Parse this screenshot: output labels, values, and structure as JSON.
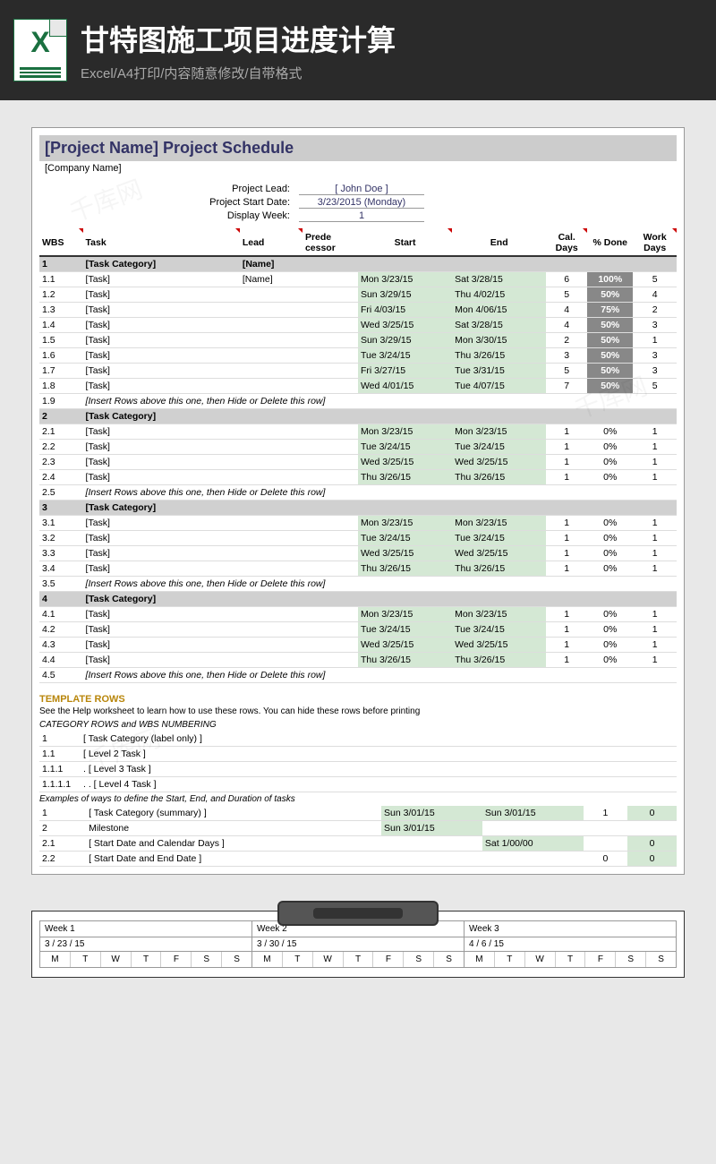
{
  "header": {
    "title": "甘特图施工项目进度计算",
    "subtitle": "Excel/A4打印/内容随意修改/自带格式"
  },
  "sheet": {
    "title": "[Project Name] Project Schedule",
    "company": "[Company Name]",
    "info": {
      "lead_lbl": "Project Lead:",
      "lead": "[ John Doe ]",
      "start_lbl": "Project Start Date:",
      "start": "3/23/2015 (Monday)",
      "week_lbl": "Display Week:",
      "week": "1"
    },
    "cols": {
      "wbs": "WBS",
      "task": "Task",
      "lead": "Lead",
      "pred": "Prede cessor",
      "start": "Start",
      "end": "End",
      "cal": "Cal. Days",
      "pct": "% Done",
      "work": "Work Days"
    },
    "rows": [
      {
        "t": "cat",
        "wbs": "1",
        "task": "[Task Category]",
        "lead": "[Name]"
      },
      {
        "wbs": "1.1",
        "task": "[Task]",
        "lead": "[Name]",
        "start": "Mon 3/23/15",
        "end": "Sat 3/28/15",
        "cal": "6",
        "pct": "100%",
        "work": "5"
      },
      {
        "wbs": "1.2",
        "task": "[Task]",
        "start": "Sun 3/29/15",
        "end": "Thu 4/02/15",
        "cal": "5",
        "pct": "50%",
        "work": "4"
      },
      {
        "wbs": "1.3",
        "task": "[Task]",
        "start": "Fri 4/03/15",
        "end": "Mon 4/06/15",
        "cal": "4",
        "pct": "75%",
        "work": "2"
      },
      {
        "wbs": "1.4",
        "task": "[Task]",
        "start": "Wed 3/25/15",
        "end": "Sat 3/28/15",
        "cal": "4",
        "pct": "50%",
        "work": "3"
      },
      {
        "wbs": "1.5",
        "task": "[Task]",
        "start": "Sun 3/29/15",
        "end": "Mon 3/30/15",
        "cal": "2",
        "pct": "50%",
        "work": "1"
      },
      {
        "wbs": "1.6",
        "task": "[Task]",
        "start": "Tue 3/24/15",
        "end": "Thu 3/26/15",
        "cal": "3",
        "pct": "50%",
        "work": "3"
      },
      {
        "wbs": "1.7",
        "task": "[Task]",
        "start": "Fri 3/27/15",
        "end": "Tue 3/31/15",
        "cal": "5",
        "pct": "50%",
        "work": "3"
      },
      {
        "wbs": "1.8",
        "task": "[Task]",
        "start": "Wed 4/01/15",
        "end": "Tue 4/07/15",
        "cal": "7",
        "pct": "50%",
        "work": "5"
      },
      {
        "t": "note",
        "wbs": "1.9",
        "task": "[Insert Rows above this one, then Hide or Delete this row]"
      },
      {
        "t": "cat",
        "wbs": "2",
        "task": "[Task Category]"
      },
      {
        "wbs": "2.1",
        "task": "[Task]",
        "start": "Mon 3/23/15",
        "end": "Mon 3/23/15",
        "cal": "1",
        "pct": "0%",
        "work": "1"
      },
      {
        "wbs": "2.2",
        "task": "[Task]",
        "start": "Tue 3/24/15",
        "end": "Tue 3/24/15",
        "cal": "1",
        "pct": "0%",
        "work": "1"
      },
      {
        "wbs": "2.3",
        "task": "[Task]",
        "start": "Wed 3/25/15",
        "end": "Wed 3/25/15",
        "cal": "1",
        "pct": "0%",
        "work": "1"
      },
      {
        "wbs": "2.4",
        "task": "[Task]",
        "start": "Thu 3/26/15",
        "end": "Thu 3/26/15",
        "cal": "1",
        "pct": "0%",
        "work": "1"
      },
      {
        "t": "note",
        "wbs": "2.5",
        "task": "[Insert Rows above this one, then Hide or Delete this row]"
      },
      {
        "t": "cat",
        "wbs": "3",
        "task": "[Task Category]"
      },
      {
        "wbs": "3.1",
        "task": "[Task]",
        "start": "Mon 3/23/15",
        "end": "Mon 3/23/15",
        "cal": "1",
        "pct": "0%",
        "work": "1"
      },
      {
        "wbs": "3.2",
        "task": "[Task]",
        "start": "Tue 3/24/15",
        "end": "Tue 3/24/15",
        "cal": "1",
        "pct": "0%",
        "work": "1"
      },
      {
        "wbs": "3.3",
        "task": "[Task]",
        "start": "Wed 3/25/15",
        "end": "Wed 3/25/15",
        "cal": "1",
        "pct": "0%",
        "work": "1"
      },
      {
        "wbs": "3.4",
        "task": "[Task]",
        "start": "Thu 3/26/15",
        "end": "Thu 3/26/15",
        "cal": "1",
        "pct": "0%",
        "work": "1"
      },
      {
        "t": "note",
        "wbs": "3.5",
        "task": "[Insert Rows above this one, then Hide or Delete this row]"
      },
      {
        "t": "cat",
        "wbs": "4",
        "task": "[Task Category]"
      },
      {
        "wbs": "4.1",
        "task": "[Task]",
        "start": "Mon 3/23/15",
        "end": "Mon 3/23/15",
        "cal": "1",
        "pct": "0%",
        "work": "1"
      },
      {
        "wbs": "4.2",
        "task": "[Task]",
        "start": "Tue 3/24/15",
        "end": "Tue 3/24/15",
        "cal": "1",
        "pct": "0%",
        "work": "1"
      },
      {
        "wbs": "4.3",
        "task": "[Task]",
        "start": "Wed 3/25/15",
        "end": "Wed 3/25/15",
        "cal": "1",
        "pct": "0%",
        "work": "1"
      },
      {
        "wbs": "4.4",
        "task": "[Task]",
        "start": "Thu 3/26/15",
        "end": "Thu 3/26/15",
        "cal": "1",
        "pct": "0%",
        "work": "1"
      },
      {
        "t": "note",
        "wbs": "4.5",
        "task": "[Insert Rows above this one, then Hide or Delete this row]"
      }
    ],
    "template": {
      "hdr": "TEMPLATE ROWS",
      "note1": "See the Help worksheet to learn how to use these rows. You can hide these rows before printing",
      "note2": "CATEGORY ROWS and WBS NUMBERING",
      "rows1": [
        {
          "wbs": "1",
          "task": "[ Task Category (label only) ]"
        },
        {
          "wbs": "1.1",
          "task": "[ Level 2 Task ]"
        },
        {
          "wbs": "1.1.1",
          "task": ". [ Level 3 Task ]"
        },
        {
          "wbs": "1.1.1.1",
          "task": ". . [ Level 4 Task ]"
        }
      ],
      "note3": "Examples of ways to define the Start, End, and Duration of tasks",
      "rows2": [
        {
          "wbs": "1",
          "task": "[ Task Category (summary) ]",
          "start": "Sun 3/01/15",
          "end": "Sun 3/01/15",
          "cal": "1",
          "work": "0"
        },
        {
          "wbs": "2",
          "task": "Milestone",
          "start": "Sun 3/01/15"
        },
        {
          "wbs": "2.1",
          "task": "[ Start Date and Calendar Days ]",
          "end": "Sat 1/00/00",
          "work": "0"
        },
        {
          "wbs": "2.2",
          "task": "[ Start Date and End Date ]",
          "cal": "0",
          "work": "0"
        }
      ]
    }
  },
  "weeks": [
    {
      "h": "Week 1",
      "d": "3 / 23 / 15",
      "days": [
        "M",
        "T",
        "W",
        "T",
        "F",
        "S",
        "S"
      ]
    },
    {
      "h": "Week 2",
      "d": "3 / 30 / 15",
      "days": [
        "M",
        "T",
        "W",
        "T",
        "F",
        "S",
        "S"
      ]
    },
    {
      "h": "Week 3",
      "d": "4 / 6 / 15",
      "days": [
        "M",
        "T",
        "W",
        "T",
        "F",
        "S",
        "S"
      ]
    }
  ]
}
